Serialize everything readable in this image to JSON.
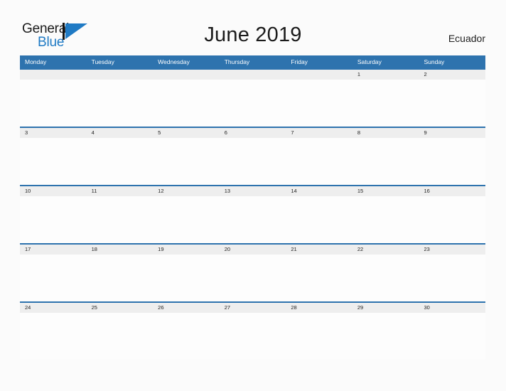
{
  "brand": {
    "name_part1": "General",
    "name_part2": "Blue",
    "logo_icon": "triangle-flag-icon",
    "accent_color": "#1f7ac4"
  },
  "header": {
    "title": "June 2019",
    "country": "Ecuador"
  },
  "colors": {
    "header_blue": "#2e73ae",
    "row_gray": "#eeeeee",
    "page_background": "#fbfbfb",
    "cell_white": "#fdfdfd"
  },
  "calendar": {
    "month": "June",
    "year": "2019",
    "weekdays": [
      "Monday",
      "Tuesday",
      "Wednesday",
      "Thursday",
      "Friday",
      "Saturday",
      "Sunday"
    ],
    "weeks": [
      [
        "",
        "",
        "",
        "",
        "",
        "1",
        "2"
      ],
      [
        "3",
        "4",
        "5",
        "6",
        "7",
        "8",
        "9"
      ],
      [
        "10",
        "11",
        "12",
        "13",
        "14",
        "15",
        "16"
      ],
      [
        "17",
        "18",
        "19",
        "20",
        "21",
        "22",
        "23"
      ],
      [
        "24",
        "25",
        "26",
        "27",
        "28",
        "29",
        "30"
      ]
    ]
  }
}
